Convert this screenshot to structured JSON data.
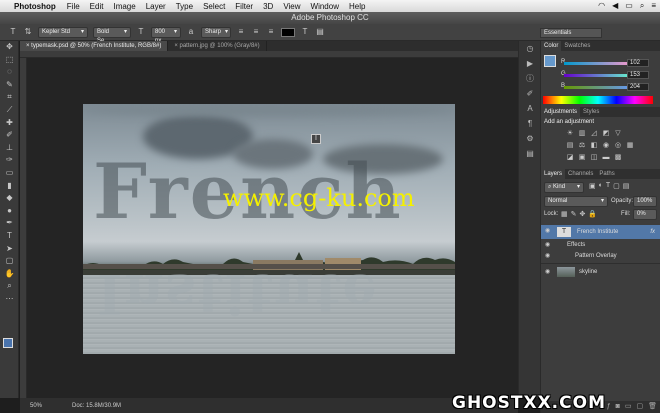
{
  "menubar": {
    "app": "Photoshop",
    "items": [
      "File",
      "Edit",
      "Image",
      "Layer",
      "Type",
      "Select",
      "Filter",
      "3D",
      "View",
      "Window",
      "Help"
    ]
  },
  "window": {
    "title": "Adobe Photoshop CC"
  },
  "options": {
    "font_family": "Kepler Std",
    "font_style": "Bold Se...",
    "font_size": "800 px",
    "antialias": "Sharp",
    "workspace": "Essentials"
  },
  "tabs": [
    {
      "label": "typemask.psd @ 50% (French  Institute, RGB/8#)"
    },
    {
      "label": "pattern.jpg @ 100% (Gray/8#)"
    }
  ],
  "canvas": {
    "title_text": "French",
    "subtitle_text": "Institute",
    "overlay_url": "www.cg-ku.com"
  },
  "status": {
    "zoom": "50%",
    "doc": "Doc: 15.8M/30.9M"
  },
  "color_panel": {
    "tabs": [
      "Color",
      "Swatches"
    ],
    "r": "102",
    "g": "153",
    "b": "204",
    "r_label": "R",
    "g_label": "G",
    "b_label": "B",
    "fg_color": "#6699cc"
  },
  "adjustments": {
    "tabs": [
      "Adjustments",
      "Styles"
    ],
    "heading": "Add an adjustment"
  },
  "layers": {
    "tabs": [
      "Layers",
      "Channels",
      "Paths"
    ],
    "filter": "Kind",
    "blend_mode": "Normal",
    "opacity_label": "Opacity:",
    "opacity_value": "100%",
    "lock_label": "Lock:",
    "fill_label": "Fill:",
    "fill_value": "0%",
    "items": [
      {
        "name": "French  Institute",
        "fx": "fx"
      },
      {
        "name": "Effects"
      },
      {
        "name": "Pattern Overlay"
      },
      {
        "name": "skyline"
      }
    ]
  },
  "watermark": {
    "text": "GHOSTXX.COM"
  }
}
